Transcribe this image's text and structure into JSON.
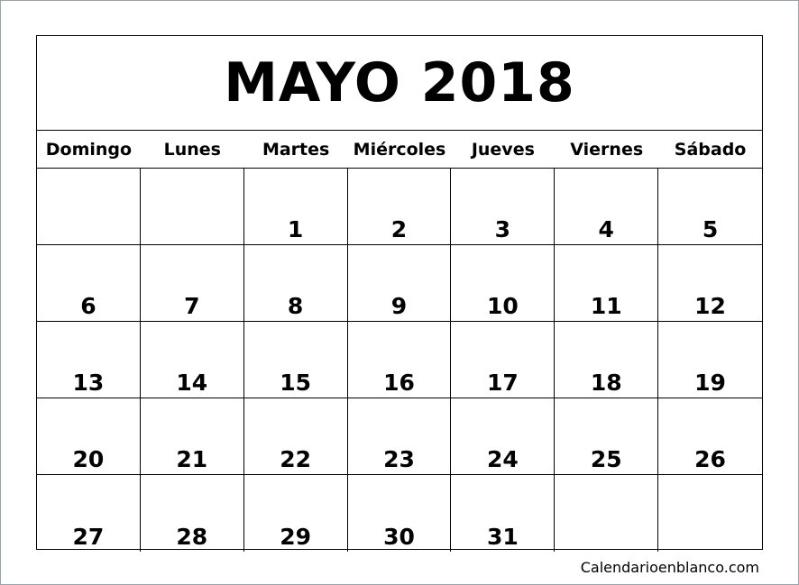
{
  "calendar": {
    "title": "MAYO 2018",
    "weekdays": [
      "Domingo",
      "Lunes",
      "Martes",
      "Miércoles",
      "Jueves",
      "Viernes",
      "Sábado"
    ],
    "days": [
      "",
      "",
      "1",
      "2",
      "3",
      "4",
      "5",
      "6",
      "7",
      "8",
      "9",
      "10",
      "11",
      "12",
      "13",
      "14",
      "15",
      "16",
      "17",
      "18",
      "19",
      "20",
      "21",
      "22",
      "23",
      "24",
      "25",
      "26",
      "27",
      "28",
      "29",
      "30",
      "31",
      "",
      ""
    ]
  },
  "footer": {
    "website": "Calendarioenblanco.com"
  }
}
